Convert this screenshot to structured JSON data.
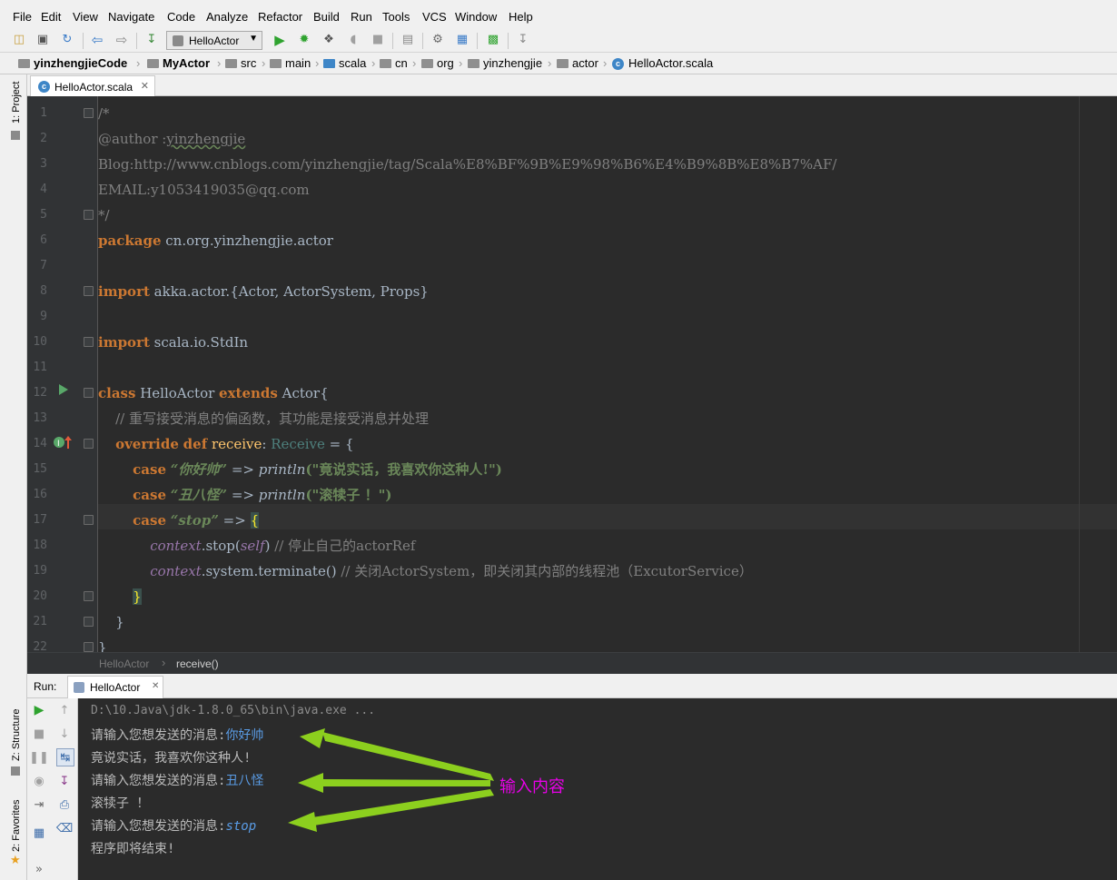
{
  "menu": [
    "File",
    "Edit",
    "View",
    "Navigate",
    "Code",
    "Analyze",
    "Refactor",
    "Build",
    "Run",
    "Tools",
    "VCS",
    "Window",
    "Help"
  ],
  "toolbar": {
    "run_config": "HelloActor",
    "icons": [
      "open-icon",
      "save-icon",
      "sync-icon",
      "back-icon",
      "forward-icon",
      "build-icon",
      "run-icon",
      "debug-icon",
      "coverage-icon",
      "profile-icon",
      "stop-icon",
      "sdk-icon",
      "settings-icon",
      "project-structure-icon",
      "sbt-icon",
      "update-icon"
    ]
  },
  "breadcrumbs": [
    "yinzhengjieCode",
    "MyActor",
    "src",
    "main",
    "scala",
    "cn",
    "org",
    "yinzhengjie",
    "actor",
    "HelloActor.scala"
  ],
  "side_tabs": {
    "project": "1: Project",
    "structure": "Z: Structure",
    "favorites": "2: Favorites"
  },
  "editor": {
    "tab_label": "HelloActor.scala",
    "line_numbers": [
      "1",
      "2",
      "3",
      "4",
      "5",
      "6",
      "7",
      "8",
      "9",
      "10",
      "11",
      "12",
      "13",
      "14",
      "15",
      "16",
      "17",
      "18",
      "19",
      "20",
      "21",
      "22"
    ],
    "lines": {
      "l1": "/*",
      "l2a": "@author :",
      "l2b": "yinzhengjie",
      "l3": "Blog:http://www.cnblogs.com/yinzhengjie/tag/Scala%E8%BF%9B%E9%98%B6%E4%B9%8B%E8%B7%AF/",
      "l4": "EMAIL:y1053419035@qq.com",
      "l5": "*/",
      "l6_kw": "package",
      "l6_rest": " cn.org.yinzhengjie.actor",
      "l8_kw": "import",
      "l8_rest": " akka.actor.{Actor, ActorSystem, Props}",
      "l10_kw": "import",
      "l10_rest": " scala.io.StdIn",
      "l12_kw1": "class",
      "l12_mid": " HelloActor ",
      "l12_kw2": "extends",
      "l12_rest": " Actor{",
      "l13": "// 重写接受消息的偏函数，其功能是接受消息并处理",
      "l14_kw1": "override",
      "l14_kw2": "def",
      "l14_fn": "receive",
      "l14_colon": ": ",
      "l14_type": "Receive",
      "l14_rest": " = {",
      "l15_kw": "case",
      "l15_str": "“你好帅”",
      "l15_arrow": " => ",
      "l15_fn": "println",
      "l15_arg": "(\"竟说实话，我喜欢你这种人!\")",
      "l16_kw": "case",
      "l16_str": "“丑八怪”",
      "l16_arrow": " => ",
      "l16_fn": "println",
      "l16_arg": "(\"滚犊子 ！\")",
      "l17_kw": "case",
      "l17_str": "“stop”",
      "l17_arrow": " => ",
      "l17_brace": "{",
      "l18_ctx": "context",
      "l18_mid": ".stop(",
      "l18_self": "self",
      "l18_close": ") ",
      "l18_cmt": "// 停止自己的actorRef",
      "l19_ctx": "context",
      "l19_mid": ".system.terminate() ",
      "l19_cmt": "// 关闭ActorSystem，即关闭其内部的线程池（ExcutorService）",
      "l20": "}",
      "l21": "}",
      "l22": "}"
    }
  },
  "code_breadcrumb": {
    "item1": "HelloActor",
    "item2": "receive()"
  },
  "run_panel": {
    "label": "Run:",
    "tab": "HelloActor",
    "command": "D:\\10.Java\\jdk-1.8.0_65\\bin\\java.exe ...",
    "output": {
      "p1": "请输入您想发送的消息:",
      "i1": "你好帅",
      "r1": "竟说实话，我喜欢你这种人!",
      "p2": "请输入您想发送的消息:",
      "i2": "丑八怪",
      "r2": "滚犊子 ！",
      "p3": "请输入您想发送的消息:",
      "i3": "stop",
      "r3": "程序即将结束!"
    }
  },
  "annotation": "输入内容",
  "colors": {
    "arrow": "#8ccf1e",
    "annotation": "#e800e8",
    "input_text": "#5a9ce6",
    "keyword": "#cc7832",
    "string": "#6a8759",
    "comment": "#808080"
  }
}
